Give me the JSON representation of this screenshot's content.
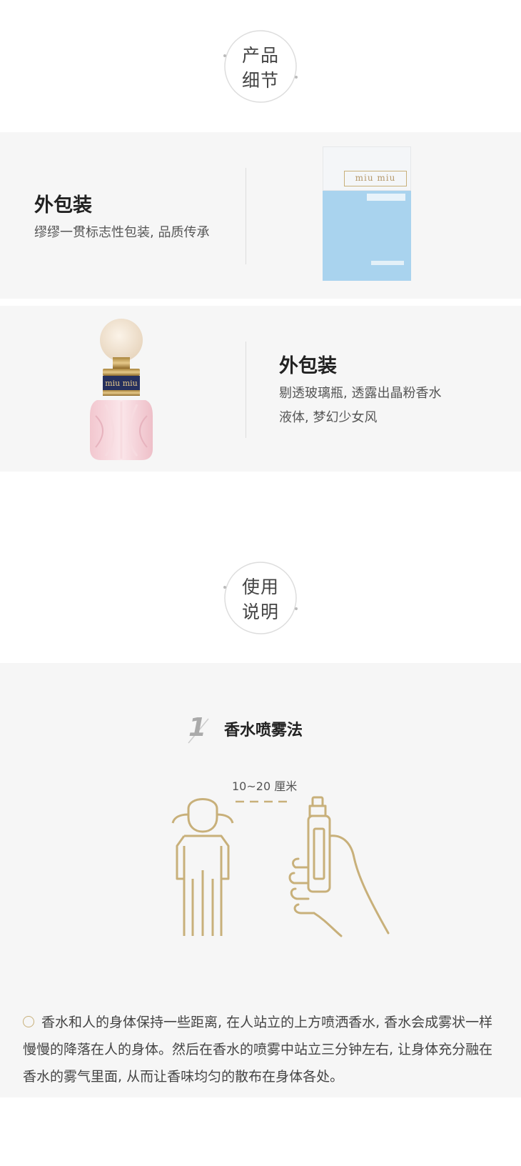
{
  "section_product": {
    "line1": "产品",
    "line2": "细节"
  },
  "feature_box": {
    "title": "外包装",
    "desc": "缪缪一贯标志性包装, 品质传承",
    "brand_mark": "miu miu"
  },
  "feature_bottle": {
    "title": "外包装",
    "desc_line1": "剔透玻璃瓶, 透露出晶粉香水",
    "desc_line2": "液体, 梦幻少女风",
    "brand_mark": "miu miu"
  },
  "section_usage": {
    "line1": "使用",
    "line2": "说明"
  },
  "usage_step": {
    "number": "1",
    "title": "香水喷雾法",
    "distance": "10~20 厘米",
    "paragraph": "香水和人的身体保持一些距离, 在人站立的上方喷洒香水, 香水会成雾状一样慢慢的降落在人的身体。然后在香水的喷雾中站立三分钟左右, 让身体充分融在香水的雾气里面, 从而让香味均匀的散布在身体各处。"
  },
  "colors": {
    "accent_gold": "#c8b07a",
    "box_blue": "#a9d3ee",
    "band_gray": "#f6f6f6"
  }
}
